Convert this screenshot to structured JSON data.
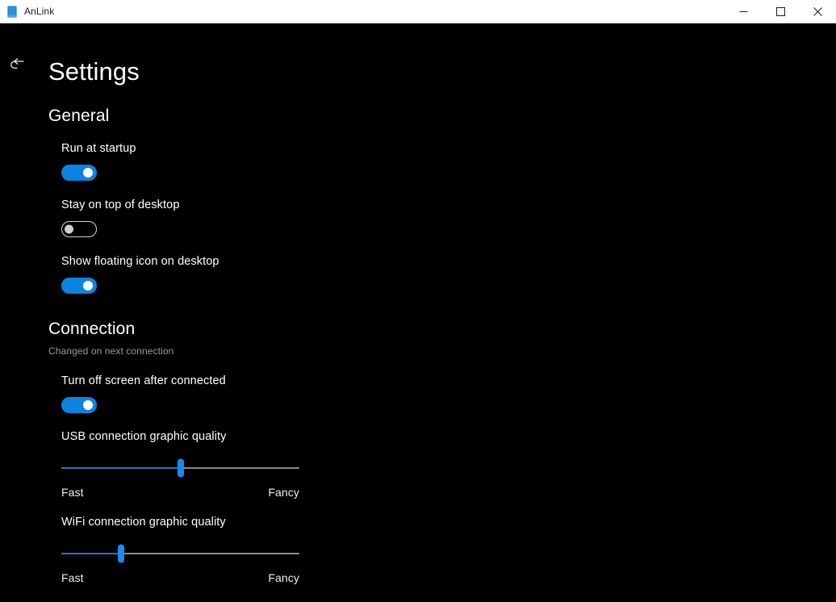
{
  "window": {
    "app_icon": "phone-icon",
    "title": "AnLink",
    "controls": {
      "minimize": "minimize-icon",
      "maximize": "maximize-icon",
      "close": "close-icon"
    }
  },
  "nav": {
    "back_icon": "back-arrow-icon"
  },
  "page": {
    "title": "Settings"
  },
  "sections": [
    {
      "id": "general",
      "title": "General",
      "note": "",
      "settings": [
        {
          "label": "Run at startup",
          "control": "toggle",
          "state": "on"
        },
        {
          "label": "Stay on top of desktop",
          "control": "toggle",
          "state": "off"
        },
        {
          "label": "Show floating icon on desktop",
          "control": "toggle",
          "state": "on"
        }
      ]
    },
    {
      "id": "connection",
      "title": "Connection",
      "note": "Changed on next connection",
      "settings": [
        {
          "label": "Turn off screen after connected",
          "control": "toggle",
          "state": "on"
        },
        {
          "label": "USB connection graphic quality",
          "control": "slider",
          "value_percent": 50,
          "min_label": "Fast",
          "max_label": "Fancy"
        },
        {
          "label": "WiFi connection graphic quality",
          "control": "slider",
          "value_percent": 25,
          "min_label": "Fast",
          "max_label": "Fancy"
        }
      ]
    }
  ],
  "colors": {
    "accent": "#0a84e0",
    "slider_thumb": "#1a8bf0",
    "slider_fill": "#2f6fc4",
    "slider_track": "#8a8a8a",
    "background": "#000000",
    "titlebar": "#ffffff",
    "note_text": "#9a9a9a"
  }
}
